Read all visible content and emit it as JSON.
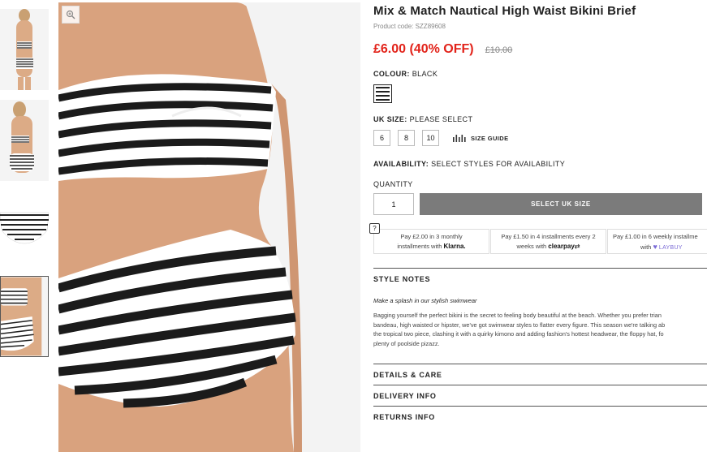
{
  "product": {
    "title": "Mix & Match Nautical High Waist Bikini Brief",
    "code": "Product code: SZZ89608",
    "price_now": "£6.00 (40% OFF)",
    "price_was": "£10.00"
  },
  "colour": {
    "label": "COLOUR:",
    "value": "BLACK"
  },
  "size": {
    "label": "UK SIZE:",
    "value": "PLEASE SELECT",
    "options": [
      "6",
      "8",
      "10"
    ],
    "guide_label": "SIZE GUIDE"
  },
  "availability": {
    "label": "AVAILABILITY:",
    "value": "SELECT STYLES FOR AVAILABILITY"
  },
  "quantity": {
    "label": "QUANTITY",
    "value": "1"
  },
  "add_button": "SELECT UK SIZE",
  "help_icon": "?",
  "payments": {
    "klarna": {
      "text1": "Pay £2.00 in 3 monthly",
      "text2": "installments with",
      "brand": "Klarna."
    },
    "clearpay": {
      "text1": "Pay £1.50 in 4 installments every 2",
      "text2": "weeks with",
      "brand": "clearpay"
    },
    "laybuy": {
      "text1": "Pay £1.00 in 6 weekly installme",
      "text2": "with",
      "brand": "LAYBUY"
    }
  },
  "style_notes": {
    "heading": "STYLE NOTES",
    "subheading": "Make a splash in our stylish swimwear",
    "lines": [
      "Bagging yourself the perfect bikini is the secret to feeling body beautiful at the beach. Whether you prefer trian",
      "bandeau, high waisted or hipster, we've got swimwear styles to flatter every figure. This season we're talking ab",
      "the tropical two piece, clashing it with a quirky kimono and adding fashion's hottest headwear, the floppy hat, fo",
      "plenty of poolside pizazz."
    ]
  },
  "sections": {
    "details": "DETAILS & CARE",
    "delivery": "DELIVERY INFO",
    "returns": "RETURNS INFO"
  },
  "colors": {
    "sale_red": "#e2231a",
    "button_grey": "#7b7b7b",
    "skin": "#d9a27e",
    "stripe": "#1b1b1b"
  }
}
